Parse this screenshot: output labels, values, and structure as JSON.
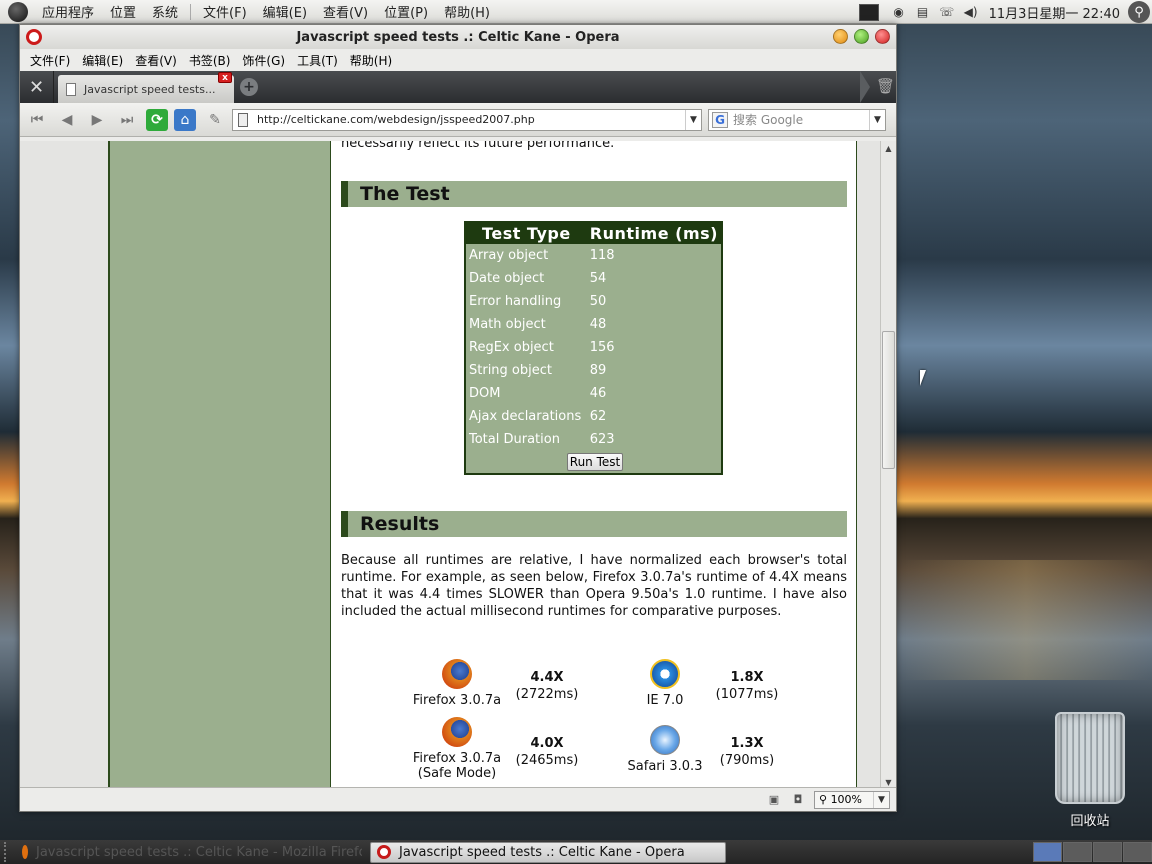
{
  "top_panel": {
    "menus": [
      "应用程序",
      "位置",
      "系统"
    ],
    "window_menus": [
      "文件(F)",
      "编辑(E)",
      "查看(V)",
      "位置(P)",
      "帮助(H)"
    ],
    "clock": "11月3日星期一 22:40"
  },
  "window": {
    "title": "Javascript speed tests .: Celtic Kane - Opera",
    "menubar": [
      "文件(F)",
      "编辑(E)",
      "查看(V)",
      "书签(B)",
      "饰件(G)",
      "工具(T)",
      "帮助(H)"
    ],
    "tab_title": "Javascript speed tests...",
    "address": "http://celtickane.com/webdesign/jsspeed2007.php",
    "search_placeholder": "搜索 Google",
    "zoom": "100%"
  },
  "page": {
    "top_text": "necessarily reflect its future performance.",
    "test_heading": "The Test",
    "table": {
      "headers": [
        "Test Type",
        "Runtime (ms)"
      ],
      "rows": [
        [
          "Array object",
          "118"
        ],
        [
          "Date object",
          "54"
        ],
        [
          "Error handling",
          "50"
        ],
        [
          "Math object",
          "48"
        ],
        [
          "RegEx object",
          "156"
        ],
        [
          "String object",
          "89"
        ],
        [
          "DOM",
          "46"
        ],
        [
          "Ajax declarations",
          "62"
        ],
        [
          "Total Duration",
          "623"
        ]
      ],
      "run_button": "Run Test"
    },
    "results_heading": "Results",
    "results_text": "Because all runtimes are relative, I have normalized each browser's total runtime. For example, as seen below, Firefox 3.0.7a's runtime of 4.4X means that it was 4.4 times SLOWER than Opera 9.50a's 1.0 runtime. I have also included the actual millisecond runtimes for comparative purposes.",
    "browsers": [
      {
        "name": "Firefox 3.0.7a",
        "ratio": "4.4X",
        "ms": "(2722ms)"
      },
      {
        "name": "IE 7.0",
        "ratio": "1.8X",
        "ms": "(1077ms)"
      },
      {
        "name": "Firefox 3.0.7a",
        "name2": "(Safe Mode)",
        "ratio": "4.0X",
        "ms": "(2465ms)"
      },
      {
        "name": "Safari 3.0.3",
        "ratio": "1.3X",
        "ms": "(790ms)"
      }
    ]
  },
  "desktop": {
    "trash_label": "回收站"
  },
  "bottom_panel": {
    "task1": "Javascript speed tests .: Celtic Kane - Mozilla Firefox",
    "task2": "Javascript speed tests .: Celtic Kane - Opera"
  }
}
